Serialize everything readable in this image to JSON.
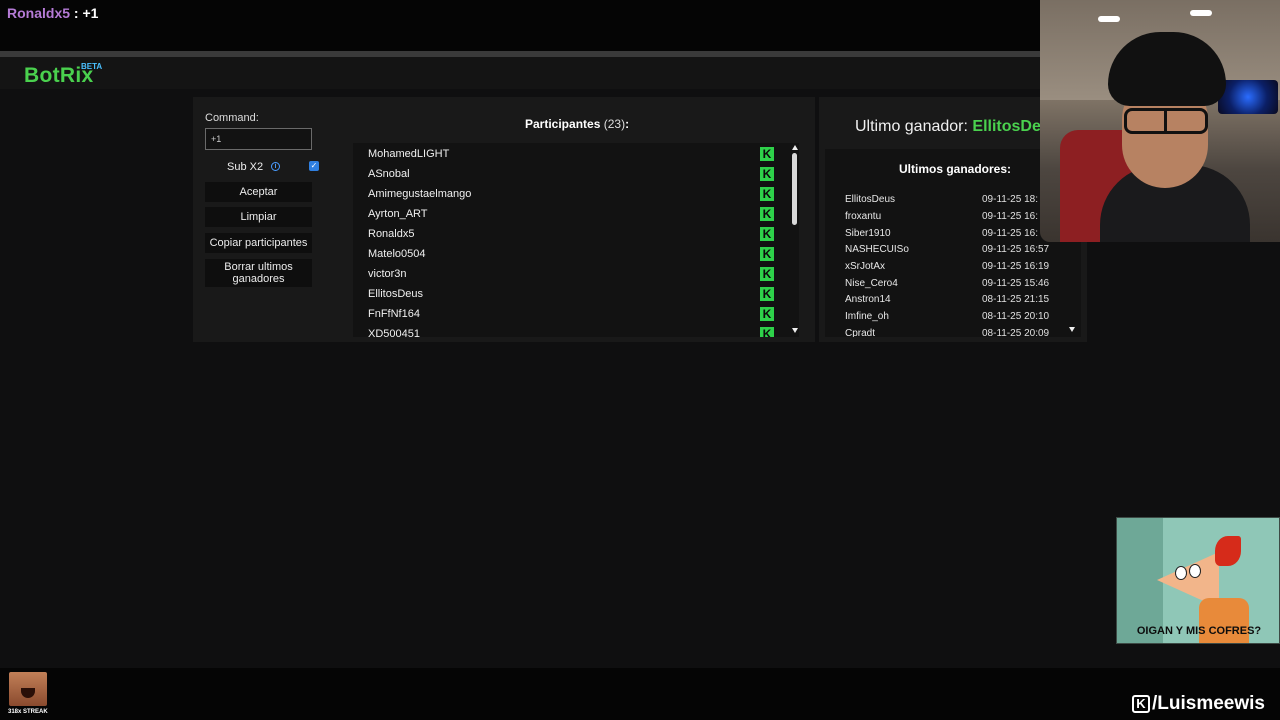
{
  "chat": {
    "user": "Ronaldx5",
    "separator": " : ",
    "message": "+1"
  },
  "app": {
    "logo": "BotRix",
    "logo_badge": "BETA"
  },
  "controls": {
    "command_label": "Command:",
    "command_value": "+1",
    "sub_label": "Sub X2",
    "sub_checked": true,
    "accept": "Aceptar",
    "clear": "Limpiar",
    "copy": "Copiar participantes",
    "delete_line1": "Borrar ultimos",
    "delete_line2": "ganadores"
  },
  "participants": {
    "title": "Participantes",
    "count": "(23)",
    "colon": ":",
    "items": [
      "MohamedLIGHT",
      "ASnobal",
      "Amimegustaelmango",
      "Ayrton_ART",
      "Ronaldx5",
      "Matelo0504",
      "victor3n",
      "EllitosDeus",
      "FnFfNf164",
      "XD500451"
    ]
  },
  "winners": {
    "last_label": "Ultimo ganador: ",
    "last_name": "EllitosDeus",
    "title": "Ultimos ganadores:",
    "items": [
      {
        "name": "EllitosDeus",
        "date": "09-11-25 18:"
      },
      {
        "name": "froxantu",
        "date": "09-11-25 16:"
      },
      {
        "name": "Siber1910",
        "date": "09-11-25 16:"
      },
      {
        "name": "NASHECUISo",
        "date": "09-11-25 16:57"
      },
      {
        "name": "xSrJotAx",
        "date": "09-11-25 16:19"
      },
      {
        "name": "Nise_Cero4",
        "date": "09-11-25 15:46"
      },
      {
        "name": "Anstron14",
        "date": "08-11-25 21:15"
      },
      {
        "name": "Imfine_oh",
        "date": "08-11-25 20:10"
      },
      {
        "name": "Cpradt",
        "date": "08-11-25 20:09"
      }
    ]
  },
  "overlay": {
    "meme_caption": "OIGAN Y MIS COFRES?",
    "streak": "318x STREAK",
    "channel": "/Luismeewis",
    "kick_glyph": "K"
  },
  "colors": {
    "accent_green": "#4ad14e",
    "kick_green": "#2ed24a",
    "chat_user": "#b57bd6",
    "beta_blue": "#4ac0ff"
  }
}
